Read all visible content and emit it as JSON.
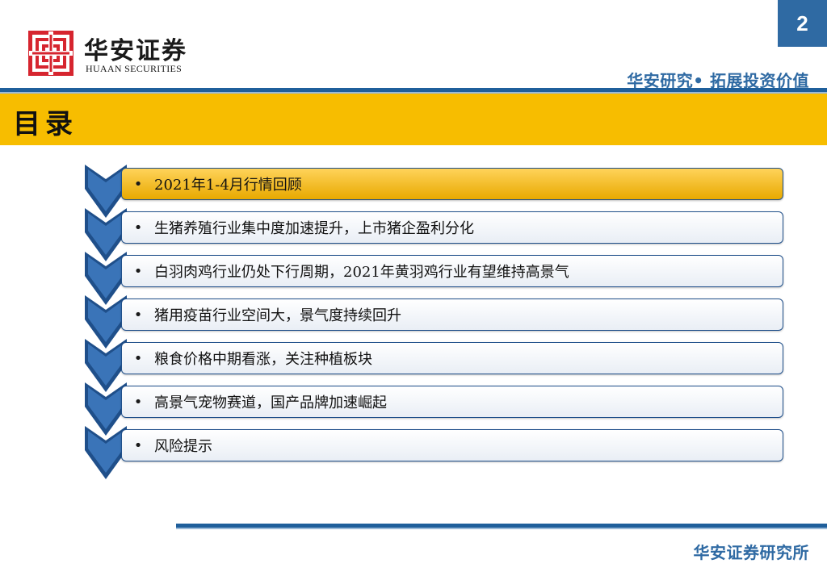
{
  "header": {
    "brand_cn": "华安证券",
    "brand_en": "HUAAN SECURITIES",
    "page_number": "2",
    "slogan": "华安研究• 拓展投资价值"
  },
  "title": "目录",
  "toc": {
    "bullet": "•",
    "items": [
      {
        "label": "2021年1-4月行情回顾",
        "active": true
      },
      {
        "label": "生猪养殖行业集中度加速提升，上市猪企盈利分化",
        "active": false
      },
      {
        "label": "白羽肉鸡行业仍处下行周期，2021年黄羽鸡行业有望维持高景气",
        "active": false
      },
      {
        "label": "猪用疫苗行业空间大，景气度持续回升",
        "active": false
      },
      {
        "label": "粮食价格中期看涨，关注种植板块",
        "active": false
      },
      {
        "label": "高景气宠物赛道，国产品牌加速崛起",
        "active": false
      },
      {
        "label": "风险提示",
        "active": false
      }
    ]
  },
  "footer": {
    "text": "华安证券研究所"
  },
  "colors": {
    "brand_blue": "#2f6aa3",
    "band_yellow": "#f7bd00",
    "logo_red": "#d6252f",
    "chevron_blue": "#1f4f8a"
  }
}
